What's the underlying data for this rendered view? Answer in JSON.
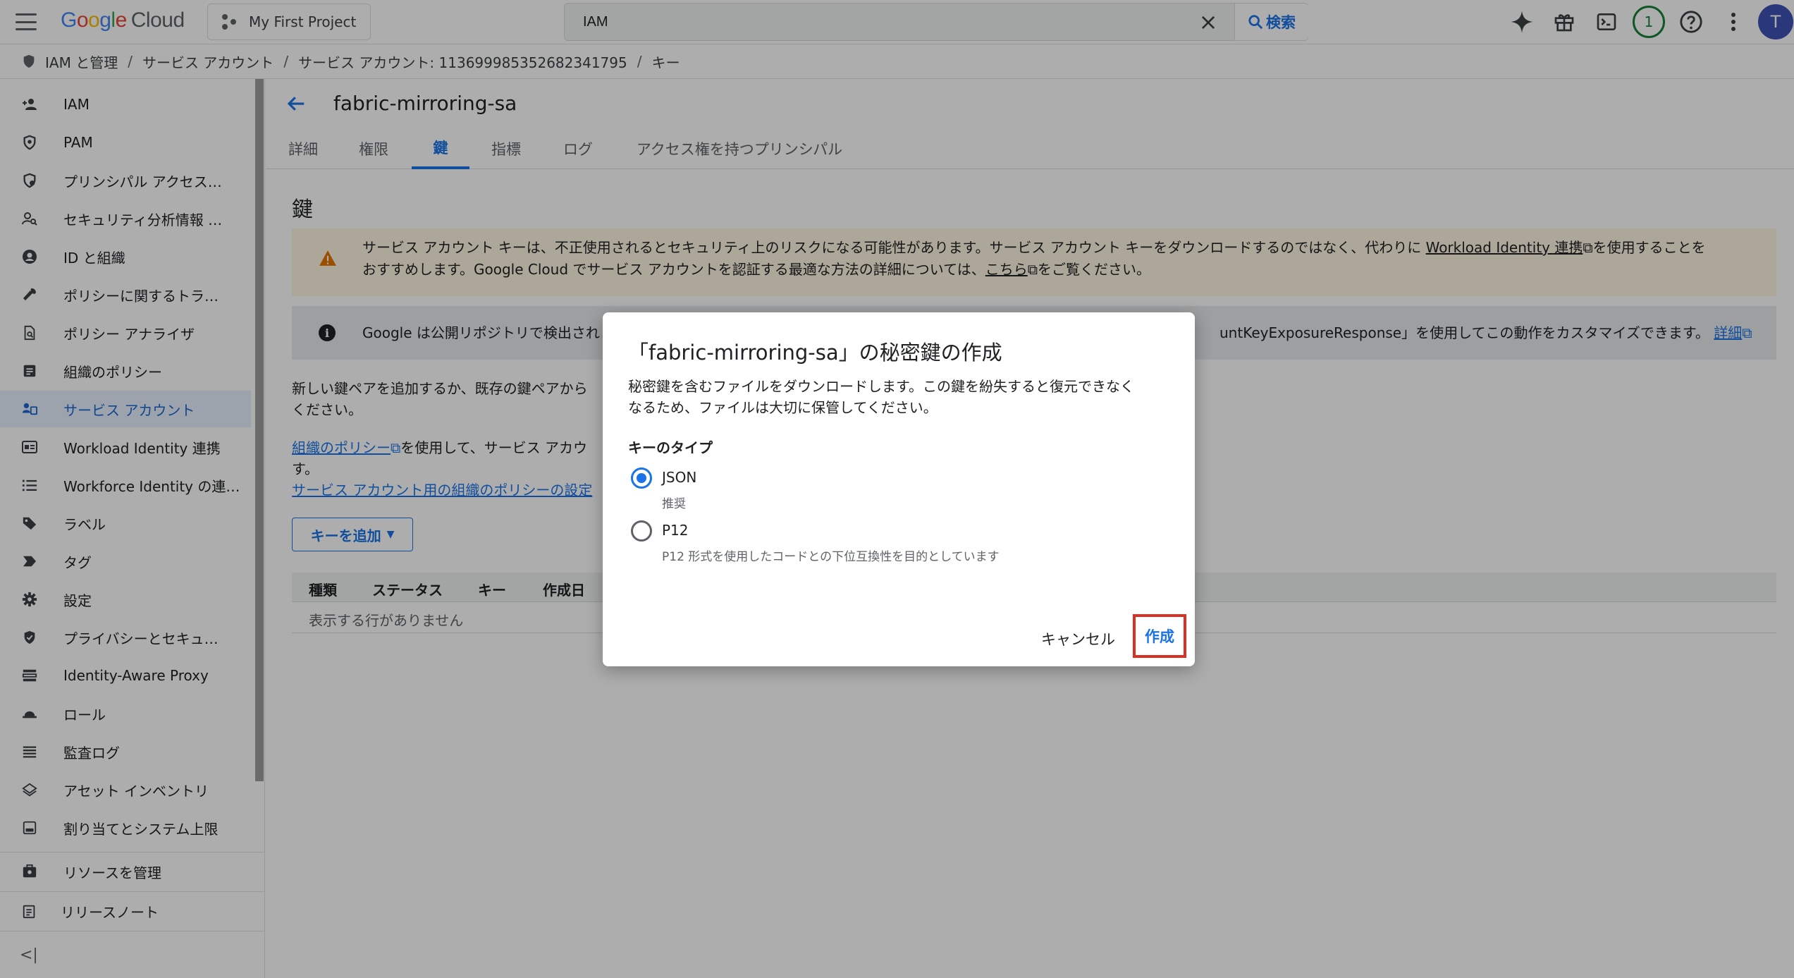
{
  "topbar": {
    "logo_google": "Google",
    "logo_cloud": "Cloud",
    "project": "My First Project",
    "search_value": "IAM",
    "search_button": "検索",
    "notification_count": "1",
    "avatar_initial": "T",
    "accent": "#1a73e8"
  },
  "breadcrumb": {
    "items": [
      "IAM と管理",
      "サービス アカウント",
      "サービス アカウント: 113699985352682341795",
      "キー"
    ]
  },
  "sidebar": {
    "items": [
      {
        "label": "IAM",
        "icon": "person-add-icon"
      },
      {
        "label": "PAM",
        "icon": "shield-icon"
      },
      {
        "label": "プリンシパル アクセス…",
        "icon": "shield-lock-icon"
      },
      {
        "label": "セキュリティ分析情報 …",
        "icon": "person-search-icon"
      },
      {
        "label": "ID と組織",
        "icon": "account-circle-icon"
      },
      {
        "label": "ポリシーに関するトラ…",
        "icon": "wrench-icon"
      },
      {
        "label": "ポリシー アナライザ",
        "icon": "document-search-icon"
      },
      {
        "label": "組織のポリシー",
        "icon": "list-box-icon"
      },
      {
        "label": "サービス アカウント",
        "icon": "service-account-icon"
      },
      {
        "label": "Workload Identity 連携",
        "icon": "id-card-icon"
      },
      {
        "label": "Workforce Identity の連…",
        "icon": "list-icon"
      },
      {
        "label": "ラベル",
        "icon": "tag-icon"
      },
      {
        "label": "タグ",
        "icon": "label-arrow-icon"
      },
      {
        "label": "設定",
        "icon": "gear-icon"
      },
      {
        "label": "プライバシーとセキュ…",
        "icon": "shield-check-icon"
      },
      {
        "label": "Identity-Aware Proxy",
        "icon": "proxy-icon"
      },
      {
        "label": "ロール",
        "icon": "hat-icon"
      },
      {
        "label": "監査ログ",
        "icon": "lines-icon"
      },
      {
        "label": "アセット インベントリ",
        "icon": "layers-icon"
      },
      {
        "label": "割り当てとシステム上限",
        "icon": "quota-icon"
      }
    ],
    "footer": [
      {
        "label": "リソースを管理",
        "icon": "manage-resources-icon"
      },
      {
        "label": "リリースノート",
        "icon": "release-notes-icon"
      }
    ],
    "active_index": 8
  },
  "main": {
    "title": "fabric-mirroring-sa",
    "tabs": [
      "詳細",
      "権限",
      "鍵",
      "指標",
      "ログ",
      "アクセス権を持つプリンシパル"
    ],
    "active_tab": 2,
    "section_title": "鍵",
    "warning": {
      "line1_a": "サービス アカウント キーは、不正使用されるとセキュリティ上のリスクになる可能性があります。サービス アカウント キーをダウンロードするのではなく、代わりに ",
      "line1_link": "Workload Identity 連携",
      "line1_b": "を使用することを",
      "line2_a": "おすすめします。Google Cloud でサービス アカウントを認証する最適な方法の詳細については、",
      "line2_link": "こちら",
      "line2_b": "をご覧ください。"
    },
    "info": {
      "text_left": "Google は公開リポジトリで検出され",
      "text_right": "untKeyExposureResponse」を使用してこの動作をカスタマイズできます。",
      "link": "詳細"
    },
    "body_line1": "新しい鍵ペアを追加するか、既存の鍵ペアから",
    "body_line2": "ください。",
    "policy_link": "組織のポリシー",
    "policy_text": "を使用して、サービス アカウ",
    "body_line4": "す。",
    "policy_settings_link": "サービス アカウント用の組織のポリシーの設定",
    "add_key": "キーを追加",
    "table_headers": [
      "種類",
      "ステータス",
      "キー",
      "作成日"
    ],
    "table_empty": "表示する行がありません"
  },
  "dialog": {
    "title": "「fabric-mirroring-sa」の秘密鍵の作成",
    "desc_line1": "秘密鍵を含むファイルをダウンロードします。この鍵を紛失すると復元できなく",
    "desc_line2": "なるため、ファイルは大切に保管してください。",
    "key_type_label": "キーのタイプ",
    "options": [
      {
        "label": "JSON",
        "sub": "推奨",
        "checked": true
      },
      {
        "label": "P12",
        "sub": "P12 形式を使用したコードとの下位互換性を目的としています",
        "checked": false
      }
    ],
    "cancel": "キャンセル",
    "create": "作成"
  }
}
